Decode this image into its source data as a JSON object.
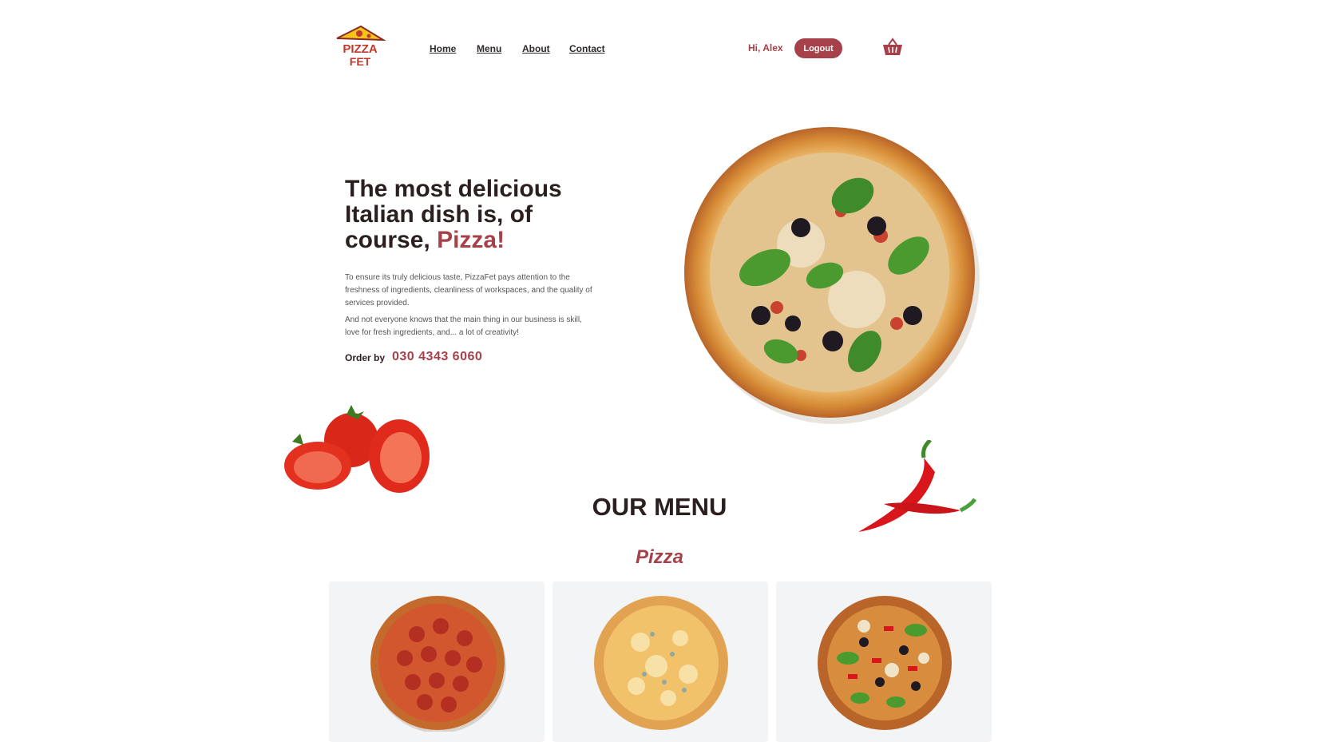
{
  "brand": {
    "logo_line1": "PIZZA",
    "logo_line2": "FET"
  },
  "nav": {
    "items": [
      "Home",
      "Menu",
      "About",
      "Contact"
    ]
  },
  "user": {
    "greeting": "Hi, Alex",
    "logout_label": "Logout"
  },
  "hero": {
    "title_main": "The most delicious Italian dish is, of course, ",
    "title_accent": "Pizza!",
    "paragraph1": "To ensure its truly delicious taste, PizzaFet pays attention to the freshness of ingredients, cleanliness of workspaces, and the quality of services provided.",
    "paragraph2": "And not everyone knows that the main thing in our business is skill, love for fresh ingredients, and... a lot of creativity!",
    "order_label": "Order by",
    "phone": "030 4343 6060"
  },
  "menu": {
    "title": "OUR MENU",
    "category": "Pizza",
    "cards": [
      {
        "name": ""
      },
      {
        "name": ""
      },
      {
        "name": ""
      }
    ]
  },
  "colors": {
    "accent": "#a6414a",
    "card_bg": "#f3f4f6",
    "text_dark": "#2b1f1f"
  }
}
